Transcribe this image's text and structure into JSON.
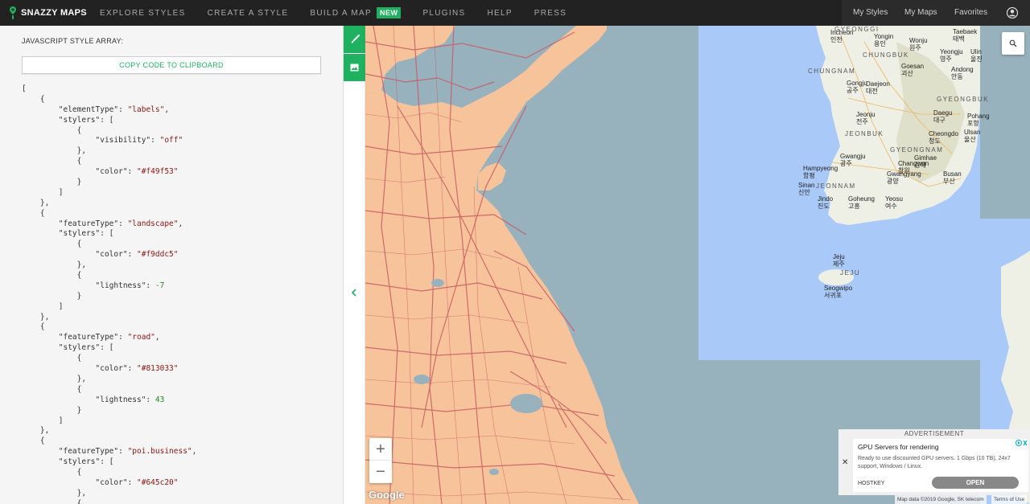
{
  "brand": {
    "name": "SNAZZY MAPS"
  },
  "nav": {
    "items": [
      {
        "label": "EXPLORE STYLES"
      },
      {
        "label": "CREATE A STYLE"
      },
      {
        "label": "BUILD A MAP",
        "badge": "NEW"
      },
      {
        "label": "PLUGINS"
      },
      {
        "label": "HELP"
      },
      {
        "label": "PRESS"
      }
    ],
    "right": {
      "my_styles": "My Styles",
      "my_maps": "My Maps",
      "favorites": "Favorites"
    }
  },
  "panel": {
    "title": "JAVASCRIPT STYLE ARRAY:",
    "copy_button": "COPY CODE TO CLIPBOARD",
    "code_lines": [
      [
        {
          "t": "p",
          "v": "["
        }
      ],
      [
        {
          "t": "p",
          "v": "    {"
        }
      ],
      [
        {
          "t": "p",
          "v": "        \"elementType\": "
        },
        {
          "t": "s",
          "v": "\"labels\""
        },
        {
          "t": "p",
          "v": ","
        }
      ],
      [
        {
          "t": "p",
          "v": "        \"stylers\": ["
        }
      ],
      [
        {
          "t": "p",
          "v": "            {"
        }
      ],
      [
        {
          "t": "p",
          "v": "                \"visibility\": "
        },
        {
          "t": "s",
          "v": "\"off\""
        }
      ],
      [
        {
          "t": "p",
          "v": "            },"
        }
      ],
      [
        {
          "t": "p",
          "v": "            {"
        }
      ],
      [
        {
          "t": "p",
          "v": "                \"color\": "
        },
        {
          "t": "s",
          "v": "\"#f49f53\""
        }
      ],
      [
        {
          "t": "p",
          "v": "            }"
        }
      ],
      [
        {
          "t": "p",
          "v": "        ]"
        }
      ],
      [
        {
          "t": "p",
          "v": "    },"
        }
      ],
      [
        {
          "t": "p",
          "v": "    {"
        }
      ],
      [
        {
          "t": "p",
          "v": "        \"featureType\": "
        },
        {
          "t": "s",
          "v": "\"landscape\""
        },
        {
          "t": "p",
          "v": ","
        }
      ],
      [
        {
          "t": "p",
          "v": "        \"stylers\": ["
        }
      ],
      [
        {
          "t": "p",
          "v": "            {"
        }
      ],
      [
        {
          "t": "p",
          "v": "                \"color\": "
        },
        {
          "t": "s",
          "v": "\"#f9ddc5\""
        }
      ],
      [
        {
          "t": "p",
          "v": "            },"
        }
      ],
      [
        {
          "t": "p",
          "v": "            {"
        }
      ],
      [
        {
          "t": "p",
          "v": "                \"lightness\": "
        },
        {
          "t": "n",
          "v": "-7"
        }
      ],
      [
        {
          "t": "p",
          "v": "            }"
        }
      ],
      [
        {
          "t": "p",
          "v": "        ]"
        }
      ],
      [
        {
          "t": "p",
          "v": "    },"
        }
      ],
      [
        {
          "t": "p",
          "v": "    {"
        }
      ],
      [
        {
          "t": "p",
          "v": "        \"featureType\": "
        },
        {
          "t": "s",
          "v": "\"road\""
        },
        {
          "t": "p",
          "v": ","
        }
      ],
      [
        {
          "t": "p",
          "v": "        \"stylers\": ["
        }
      ],
      [
        {
          "t": "p",
          "v": "            {"
        }
      ],
      [
        {
          "t": "p",
          "v": "                \"color\": "
        },
        {
          "t": "s",
          "v": "\"#813033\""
        }
      ],
      [
        {
          "t": "p",
          "v": "            },"
        }
      ],
      [
        {
          "t": "p",
          "v": "            {"
        }
      ],
      [
        {
          "t": "p",
          "v": "                \"lightness\": "
        },
        {
          "t": "n",
          "v": "43"
        }
      ],
      [
        {
          "t": "p",
          "v": "            }"
        }
      ],
      [
        {
          "t": "p",
          "v": "        ]"
        }
      ],
      [
        {
          "t": "p",
          "v": "    },"
        }
      ],
      [
        {
          "t": "p",
          "v": "    {"
        }
      ],
      [
        {
          "t": "p",
          "v": "        \"featureType\": "
        },
        {
          "t": "s",
          "v": "\"poi.business\""
        },
        {
          "t": "p",
          "v": ","
        }
      ],
      [
        {
          "t": "p",
          "v": "        \"stylers\": ["
        }
      ],
      [
        {
          "t": "p",
          "v": "            {"
        }
      ],
      [
        {
          "t": "p",
          "v": "                \"color\": "
        },
        {
          "t": "s",
          "v": "\"#645c20\""
        }
      ],
      [
        {
          "t": "p",
          "v": "            },"
        }
      ],
      [
        {
          "t": "p",
          "v": "            {"
        }
      ]
    ]
  },
  "map": {
    "regions": [
      "GYEONGGI",
      "CHUNGBUK",
      "CHUNGNAM",
      "GYEONGBUK",
      "JEONBUK",
      "GYEONGNAM",
      "JEONNAM",
      "JEJU"
    ],
    "cities": [
      "Incheon",
      "인천",
      "Yongin",
      "용인",
      "Wonju",
      "원주",
      "Taebaek",
      "태백",
      "Ulin",
      "울진",
      "Yeongju",
      "영주",
      "Goesan",
      "괴산",
      "Andong",
      "안동",
      "Daejeon",
      "대전",
      "Gongju",
      "공주",
      "Jeonju",
      "전주",
      "Daegu",
      "대구",
      "Pohang",
      "포항",
      "Ulsan",
      "울산",
      "Gwangju",
      "광주",
      "Gimhae",
      "김해",
      "Busan",
      "부산",
      "Changwon",
      "창원",
      "Hampyeong",
      "함평",
      "Gwangyang",
      "광양",
      "Sinan",
      "신안",
      "Jindo",
      "진도",
      "Goheung",
      "고흥",
      "Yeosu",
      "여수",
      "Jeju",
      "제주",
      "Seogwipo",
      "서귀포",
      "Cheongdo",
      "청도"
    ],
    "colors": {
      "land": "#f6c39b",
      "water": "#97b1bd",
      "road": "#c95b63",
      "korea_land": "#eef0e6",
      "korea_sea": "#a9c9f8"
    },
    "zoom_in": "+",
    "zoom_out": "−",
    "google": "Google",
    "credits": "Map data ©2019 Google, SK telecom",
    "terms": "Terms of Use"
  },
  "ad": {
    "header": "ADVERTISEMENT",
    "close": "✕",
    "title": "GPU Servers for rendering",
    "body": "Ready to use discounted GPU servers. 1 Gbps (10 TB), 24x7 support, Windows / Linux.",
    "brand": "HOSTKEY",
    "cta": "OPEN"
  }
}
